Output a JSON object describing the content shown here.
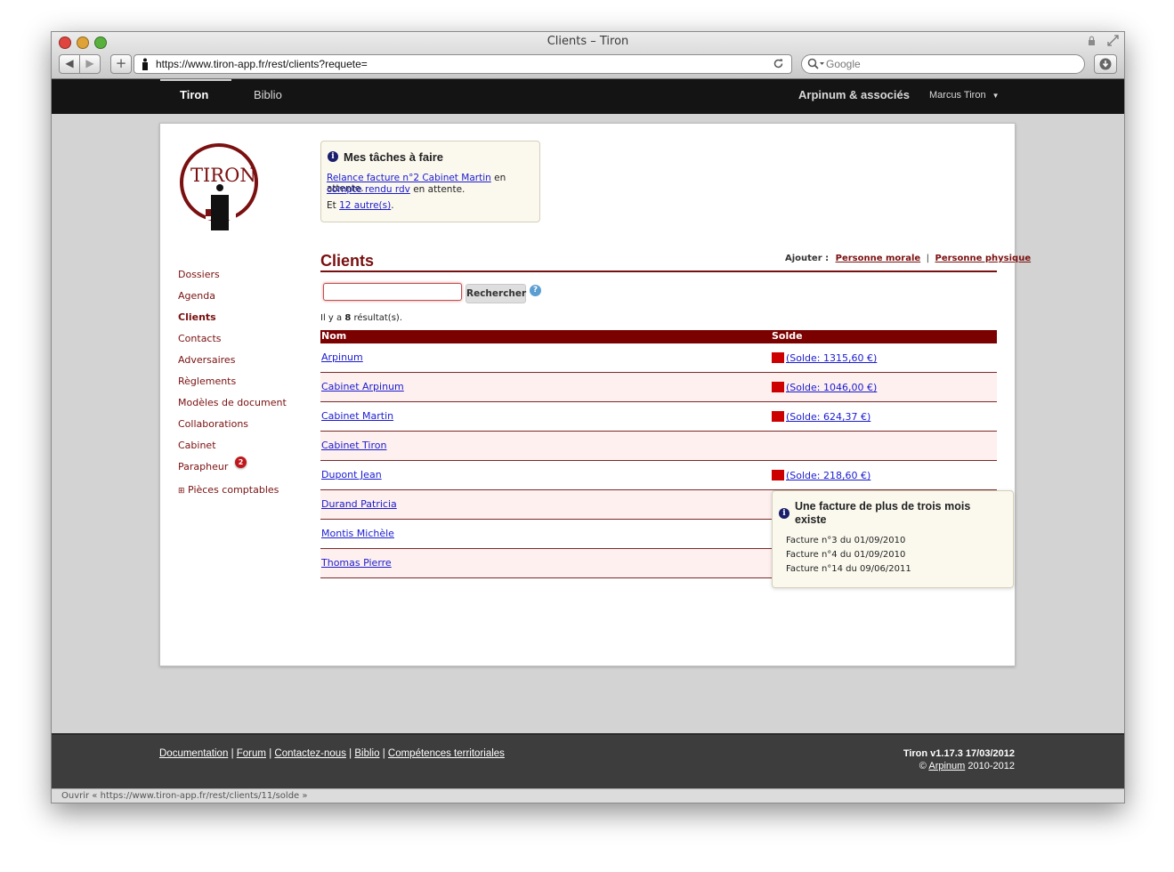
{
  "browser": {
    "window_title": "Clients – Tiron",
    "url": "https://www.tiron-app.fr/rest/clients?requete=",
    "search_placeholder": "Google",
    "status_text": "Ouvrir « https://www.tiron-app.fr/rest/clients/11/solde »"
  },
  "topnav": {
    "tabs": [
      {
        "label": "Tiron"
      },
      {
        "label": "Biblio"
      }
    ],
    "firm": "Arpinum & associés",
    "user": "Marcus Tiron"
  },
  "logo": {
    "text": "TIRON"
  },
  "sidebar": {
    "items": [
      {
        "label": "Dossiers"
      },
      {
        "label": "Agenda"
      },
      {
        "label": "Clients"
      },
      {
        "label": "Contacts"
      },
      {
        "label": "Adversaires"
      },
      {
        "label": "Règlements"
      },
      {
        "label": "Modèles de document"
      },
      {
        "label": "Collaborations"
      },
      {
        "label": "Cabinet"
      },
      {
        "label": "Parapheur"
      },
      {
        "label": "Pièces comptables"
      }
    ],
    "parapheur_badge": "2",
    "expand_symbol": "⊞"
  },
  "tasks": {
    "title": "Mes tâches à faire",
    "line1_link": "Relance facture n°2 Cabinet Martin",
    "line1_rest": " en attente.",
    "line2_link": "compte rendu rdv",
    "line2_rest": " en attente.",
    "line3_pre": "Et ",
    "line3_link": "12 autre(s)",
    "line3_post": "."
  },
  "clients": {
    "title": "Clients",
    "add_label": "Ajouter :",
    "add_moral": "Personne morale",
    "add_sep": "|",
    "add_physique": "Personne physique",
    "search_button": "Rechercher",
    "help_symbol": "?",
    "result_pre": "Il y a ",
    "result_count": "8",
    "result_post": " résultat(s).",
    "col_nom": "Nom",
    "col_solde": "Solde",
    "rows": [
      {
        "name": "Arpinum",
        "solde": "(Solde: 1315,60 €)"
      },
      {
        "name": "Cabinet Arpinum",
        "solde": "(Solde: 1046,00 €)"
      },
      {
        "name": "Cabinet Martin",
        "solde": "(Solde: 624,37 €)"
      },
      {
        "name": "Cabinet Tiron",
        "solde": ""
      },
      {
        "name": "Dupont Jean",
        "solde": "(Solde: 218,60 €)"
      },
      {
        "name": "Durand Patricia",
        "solde": ""
      },
      {
        "name": "Montis Michèle",
        "solde": ""
      },
      {
        "name": "Thomas Pierre",
        "solde": ""
      }
    ]
  },
  "tooltip": {
    "title": "Une facture de plus de trois mois existe",
    "lines": [
      "Facture n°3 du 01/09/2010",
      "Facture n°4 du 01/09/2010",
      "Facture n°14 du 09/06/2011"
    ]
  },
  "footer": {
    "links": [
      "Documentation",
      "Forum",
      "Contactez-nous",
      "Biblio",
      "Compétences territoriales"
    ],
    "sep": "|",
    "version": "Tiron v1.17.3 17/03/2012",
    "copyright_symbol": "©",
    "copyright_link": "Arpinum",
    "copyright_years": "2010-2012"
  },
  "colors": {
    "brand": "#7a0f0f",
    "header_bg": "#7b0000",
    "solde_flag": "#cc0000",
    "link": "#1b1bd1"
  }
}
